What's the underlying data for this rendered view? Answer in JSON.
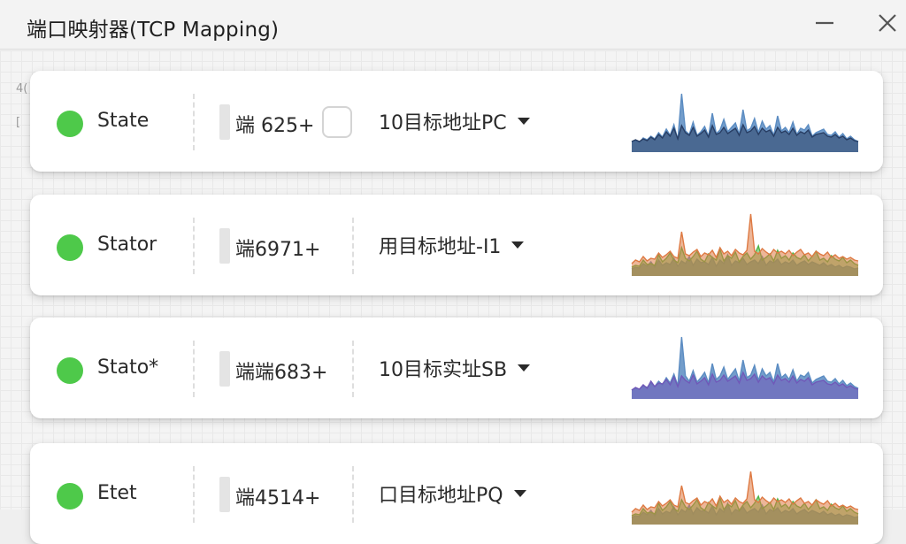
{
  "window": {
    "title": "端口映射器(TCP Mapping)",
    "minimize_icon": "minimize-icon",
    "close_icon": "close-icon"
  },
  "background": {
    "text_1": "4(",
    "text_2": "["
  },
  "colors": {
    "status_active": "#4ec94a",
    "blue": "#5b8cc2",
    "navy": "#283e64",
    "orange": "#de7a43",
    "green": "#4bb445",
    "purple": "#7058b8"
  },
  "mappings": [
    {
      "state": "State",
      "port": "端 625+",
      "has_checkbox": true,
      "target": "10目标地址PC",
      "chart_data": {
        "type": "area",
        "series": [
          {
            "color": "#5b8cc2",
            "values": [
              12,
              13,
              11,
              16,
              14,
              18,
              15,
              22,
              17,
              26,
              19,
              31,
              14,
              66,
              24,
              20,
              34,
              19,
              23,
              29,
              18,
              44,
              21,
              25,
              37,
              23,
              28,
              33,
              20,
              48,
              24,
              27,
              38,
              22,
              35,
              26,
              30,
              19,
              41,
              24,
              28,
              22,
              34,
              20,
              27,
              25,
              31,
              18,
              22,
              24,
              26,
              20,
              19,
              23,
              17,
              21,
              15,
              18,
              14,
              12
            ]
          },
          {
            "color": "#283e64",
            "values": [
              12,
              14,
              12,
              15,
              13,
              17,
              14,
              20,
              16,
              23,
              18,
              27,
              15,
              30,
              22,
              19,
              28,
              18,
              21,
              25,
              17,
              30,
              20,
              22,
              28,
              21,
              24,
              27,
              19,
              31,
              22,
              24,
              29,
              20,
              27,
              23,
              25,
              18,
              28,
              22,
              24,
              20,
              27,
              19,
              23,
              21,
              25,
              17,
              20,
              21,
              22,
              18,
              17,
              20,
              16,
              18,
              14,
              16,
              13,
              12
            ]
          }
        ]
      }
    },
    {
      "state": "Stator",
      "port": "端6971+",
      "has_checkbox": false,
      "target": "用目标地址-I1",
      "chart_data": {
        "type": "area",
        "series": [
          {
            "color": "#5b8cc2",
            "values": [
              8,
              10,
              9,
              14,
              11,
              16,
              10,
              18,
              12,
              15,
              13,
              20,
              11,
              17,
              14,
              22,
              12,
              19,
              15,
              16,
              13,
              21,
              11,
              18,
              14,
              24,
              12,
              17,
              15,
              20,
              13,
              16,
              18,
              14,
              22,
              12,
              17,
              15,
              19,
              13,
              16,
              14,
              18,
              12,
              15,
              17,
              13,
              16,
              14,
              12,
              15,
              11,
              13,
              10,
              12,
              9,
              11,
              10,
              8,
              9
            ]
          },
          {
            "color": "#4bb445",
            "values": [
              10,
              12,
              11,
              18,
              13,
              14,
              12,
              24,
              16,
              20,
              26,
              18,
              15,
              32,
              20,
              17,
              22,
              28,
              19,
              16,
              25,
              21,
              18,
              30,
              17,
              23,
              20,
              27,
              16,
              22,
              26,
              19,
              24,
              34,
              18,
              21,
              25,
              17,
              29,
              20,
              23,
              18,
              26,
              21,
              19,
              24,
              17,
              22,
              28,
              18,
              20,
              16,
              23,
              19,
              17,
              21,
              15,
              18,
              14,
              12
            ]
          },
          {
            "color": "#de7a43",
            "values": [
              14,
              18,
              16,
              22,
              17,
              20,
              19,
              26,
              21,
              24,
              28,
              22,
              20,
              50,
              25,
              23,
              27,
              30,
              22,
              26,
              24,
              29,
              21,
              32,
              25,
              28,
              23,
              30,
              26,
              24,
              29,
              70,
              28,
              25,
              31,
              27,
              24,
              30,
              26,
              28,
              25,
              29,
              23,
              27,
              30,
              24,
              26,
              22,
              28,
              25,
              23,
              27,
              21,
              24,
              20,
              22,
              19,
              21,
              18,
              17
            ]
          }
        ]
      }
    },
    {
      "state": "Stato*",
      "port": "端端683+",
      "has_checkbox": false,
      "target": "10目标实址SB",
      "chart_data": {
        "type": "area",
        "series": [
          {
            "color": "#5b8cc2",
            "values": [
              10,
              12,
              11,
              15,
              13,
              18,
              14,
              20,
              16,
              24,
              18,
              28,
              15,
              70,
              26,
              20,
              32,
              19,
              24,
              30,
              18,
              40,
              22,
              26,
              36,
              22,
              28,
              34,
              20,
              44,
              24,
              27,
              38,
              21,
              34,
              26,
              30,
              19,
              40,
              24,
              28,
              22,
              33,
              20,
              27,
              25,
              30,
              18,
              22,
              24,
              26,
              20,
              19,
              23,
              17,
              21,
              15,
              18,
              14,
              12
            ]
          },
          {
            "color": "#7058b8",
            "values": [
              10,
              13,
              11,
              16,
              12,
              20,
              14,
              18,
              17,
              22,
              16,
              25,
              14,
              26,
              21,
              18,
              27,
              17,
              20,
              24,
              16,
              28,
              19,
              21,
              27,
              20,
              23,
              26,
              18,
              30,
              21,
              23,
              28,
              19,
              26,
              22,
              24,
              17,
              27,
              21,
              23,
              19,
              26,
              18,
              22,
              20,
              24,
              16,
              19,
              20,
              21,
              17,
              16,
              19,
              15,
              17,
              13,
              15,
              12,
              11
            ]
          }
        ]
      }
    },
    {
      "state": "Etet",
      "port": "端4514+",
      "has_checkbox": false,
      "target": "口目标地址PQ",
      "chart_data": {
        "type": "area",
        "series": [
          {
            "color": "#5b8cc2",
            "values": [
              8,
              10,
              9,
              14,
              11,
              16,
              10,
              18,
              12,
              15,
              13,
              20,
              11,
              17,
              14,
              22,
              12,
              19,
              15,
              16,
              13,
              21,
              11,
              18,
              14,
              24,
              12,
              17,
              15,
              20,
              13,
              16,
              18,
              14,
              22,
              12,
              17,
              15,
              19,
              13,
              16,
              14,
              18,
              12,
              15,
              17,
              13,
              16,
              14,
              12,
              15,
              11,
              13,
              10,
              12,
              9,
              11,
              10,
              8,
              9
            ]
          },
          {
            "color": "#4bb445",
            "values": [
              10,
              12,
              11,
              18,
              13,
              14,
              12,
              24,
              16,
              20,
              26,
              18,
              15,
              28,
              20,
              17,
              22,
              28,
              19,
              16,
              25,
              21,
              18,
              30,
              17,
              23,
              20,
              27,
              16,
              22,
              26,
              19,
              24,
              32,
              18,
              21,
              25,
              17,
              29,
              20,
              23,
              18,
              26,
              21,
              19,
              24,
              17,
              22,
              28,
              18,
              20,
              16,
              23,
              19,
              17,
              21,
              15,
              18,
              14,
              12
            ]
          },
          {
            "color": "#de7a43",
            "values": [
              14,
              18,
              16,
              22,
              17,
              20,
              19,
              26,
              21,
              24,
              28,
              22,
              20,
              44,
              25,
              23,
              27,
              30,
              22,
              26,
              24,
              29,
              21,
              32,
              25,
              28,
              23,
              30,
              26,
              24,
              29,
              60,
              28,
              25,
              31,
              27,
              24,
              30,
              26,
              28,
              25,
              29,
              23,
              27,
              30,
              24,
              26,
              22,
              28,
              25,
              23,
              27,
              21,
              24,
              20,
              22,
              19,
              21,
              18,
              17
            ]
          }
        ]
      }
    }
  ]
}
